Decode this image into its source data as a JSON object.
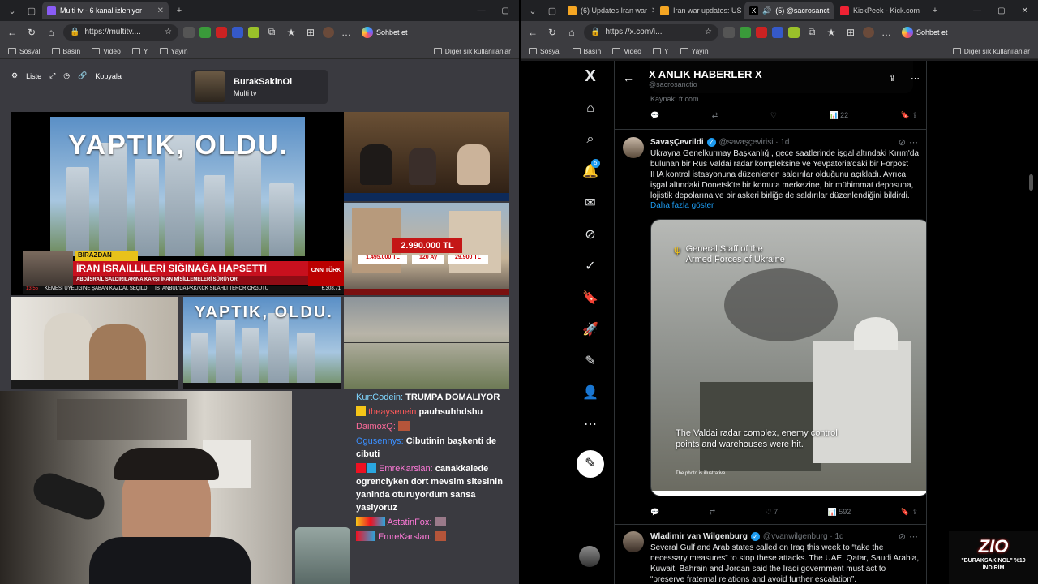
{
  "left_browser": {
    "tabs": [
      {
        "label": "Multi tv - 6 kanal izleniyor",
        "active": true
      }
    ],
    "address": "https://multitv....",
    "copilot_label": "Sohbet et",
    "bookmarks": [
      "Sosyal",
      "Basın",
      "Video",
      "Y",
      "Yayın"
    ],
    "bookmarks_right": "Diğer sık kullanılanlar"
  },
  "multitv": {
    "tool_list": "Liste",
    "tool_copy": "Kopyala",
    "channel_name": "BurakSakinOl",
    "channel_sub": "Multi tv",
    "main_video_headline": "YAPTIK, OLDU.",
    "news_tag": "BIRAZDAN",
    "news_headline": "İRAN İSRAİLLİLERİ SIĞINAĞA HAPSETTİ",
    "news_sub": "ABD/İSRAİL SALDIRILARINA KARŞI İRAN MİSİLLEMELERİ SÜRÜYOR",
    "news_ticker_time": "13:55",
    "news_ticker_1": "KEMESİ ÜYELİĞİNE ŞABAN KAZDAL SEÇİLDİ",
    "news_ticker_2": "İSTANBUL'DA PKK/KCK SİLAHLI TERÖR ÖRGÜTÜ",
    "news_ticker_value": "6.308,71",
    "news_logo": "CNN TÜRK",
    "small_video_headline": "YAPTIK, OLDU.",
    "price_main": "2.990.000 TL",
    "price_left": "1.495.000 TL",
    "price_mid": "120 Ay",
    "price_right": "29.900 TL"
  },
  "chat": [
    {
      "user": "KurtCodein:",
      "color": "#7fd6ff",
      "text": "TRUMPA DOMALIYOR"
    },
    {
      "user": "theaysenein",
      "color": "#ff5a5a",
      "text": "pauhsuhhdshu"
    },
    {
      "user": "DaimoxQ:",
      "color": "#ff6b9b",
      "text": ""
    },
    {
      "user": "Ogusennys:",
      "color": "#3a8fff",
      "text": "Cibutinin başkenti de cibuti"
    },
    {
      "user": "EmreKarslan:",
      "color": "#ff7ad9",
      "text": "canakkalede ogrenciyken dort mevsim sitesinin yaninda oturuyordum sansa yasiyoruz"
    },
    {
      "user": "AstatinFox:",
      "color": "#ff7ad9",
      "text": ""
    },
    {
      "user": "EmreKarslan:",
      "color": "#ff7ad9",
      "text": ""
    }
  ],
  "right_browser": {
    "tabs": [
      {
        "label": "(6) Updates Iran war",
        "active": false
      },
      {
        "label": "Iran war updates: US",
        "active": false
      },
      {
        "label": "(5) @sacrosanct",
        "active": true
      },
      {
        "label": "KickPeek - Kick.com",
        "active": false
      }
    ],
    "address": "https://x.com/i...",
    "copilot_label": "Sohbet et",
    "bookmarks": [
      "Sosyal",
      "Basın",
      "Video",
      "Y",
      "Yayın"
    ],
    "bookmarks_right": "Diğer sık kullanılanlar"
  },
  "x": {
    "header_title": "X ANLIK HABERLER X",
    "header_handle": "@sacrosanctio",
    "notif_count": "5",
    "tweet0": {
      "source": "Kaynak: ft.com",
      "views": "22"
    },
    "tweet1": {
      "name": "SavaşÇevrildi",
      "handle": "@savaşçevirisi · 1d",
      "text": "Ukrayna Genelkurmay Başkanlığı, gece saatlerinde işgal altındaki Kırım'da bulunan bir Rus Valdai radar kompleksine ve Yevpatoria'daki bir Forpost İHA kontrol istasyonuna düzenlenen saldırılar olduğunu açıkladı. Ayrıca işgal altındaki Donetsk'te bir komuta merkezine, bir mühimmat deposuna, lojistik depolarına ve bir askeri birliğe de saldırılar düzenlendiğini bildirdi.",
      "show_more": "Daha fazla göster",
      "media_title": "General Staff of the Armed Forces of Ukraine",
      "media_caption": "The Valdai radar complex, enemy control points and warehouses were hit.",
      "media_note": "The photo is illustrative",
      "likes": "7",
      "views": "592"
    },
    "tweet2": {
      "name": "Wladimir van Wilgenburg",
      "handle": "@vvanwilgenburg · 1d",
      "text": "Several Gulf and Arab states called on Iraq this week to “take the necessary measures” to stop these attacks. The UAE, Qatar, Saudi Arabia, Kuwait, Bahrain and Jordan said the Iraqi government must act to “preserve fraternal relations and avoid further escalation”."
    }
  },
  "overlay": {
    "brand": "ZIO",
    "promo": "\"BURAKSAKINOL\" %10 İNDİRİM"
  }
}
